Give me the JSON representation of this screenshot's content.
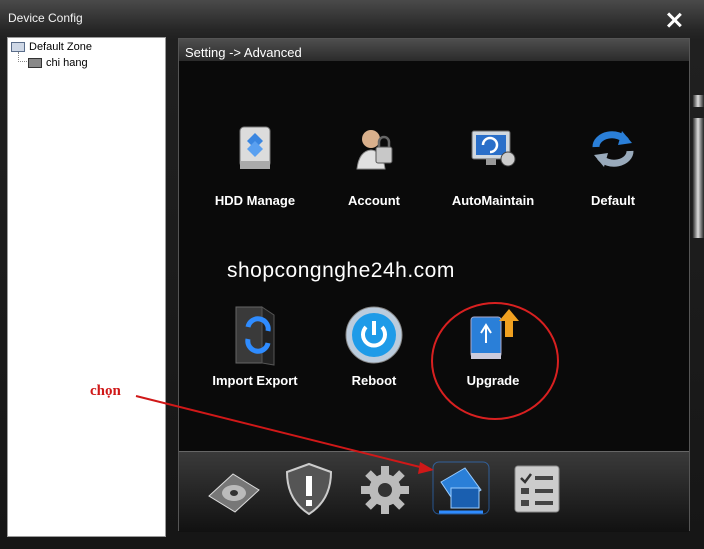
{
  "window": {
    "title": "Device Config"
  },
  "tree": {
    "root_label": "Default Zone",
    "child_label": "chi hang"
  },
  "content": {
    "breadcrumb": "Setting -> Advanced"
  },
  "tiles": [
    {
      "label": "HDD Manage",
      "icon": "hdd-manage-icon"
    },
    {
      "label": "Account",
      "icon": "account-icon"
    },
    {
      "label": "AutoMaintain",
      "icon": "automaintain-icon"
    },
    {
      "label": "Default",
      "icon": "default-icon"
    },
    {
      "label": "Import Export",
      "icon": "import-export-icon"
    },
    {
      "label": "Reboot",
      "icon": "reboot-icon"
    },
    {
      "label": "Upgrade",
      "icon": "upgrade-icon"
    }
  ],
  "watermark": "shopcongnghe24h.com",
  "annotation": {
    "text": "chọn",
    "color": "#d01818"
  },
  "bottom_icons": [
    "record-icon",
    "alarm-icon",
    "system-settings-icon",
    "advanced-icon",
    "info-icon"
  ],
  "colors": {
    "background": "#000000",
    "accent_red": "#d82020",
    "highlight_blue": "#2f8cff"
  }
}
